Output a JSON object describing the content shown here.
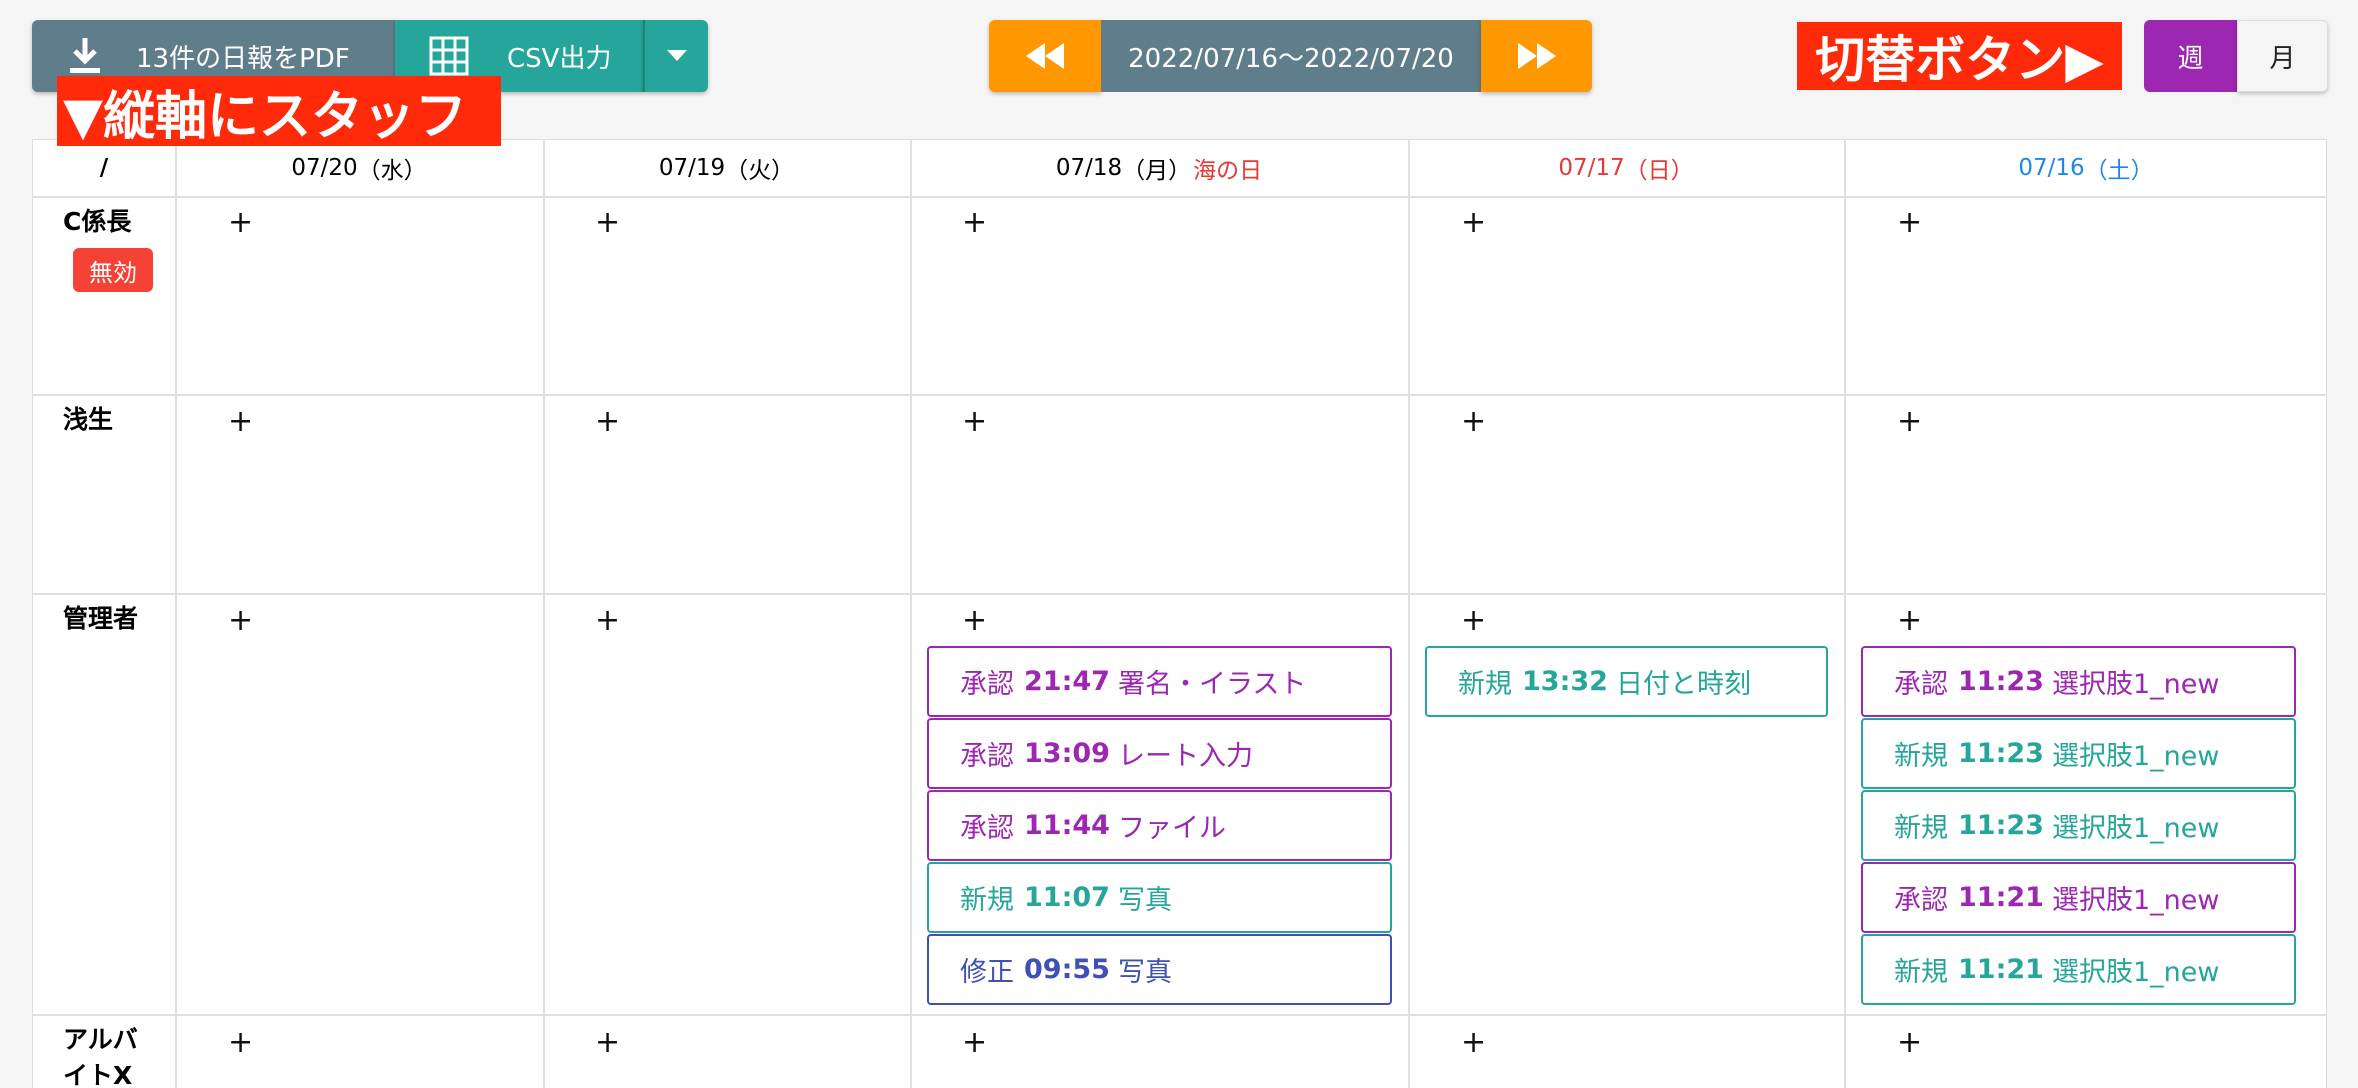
{
  "toolbar": {
    "pdf_label": "13件の日報をPDF",
    "csv_label": "CSV出力",
    "date_range": "2022/07/16〜2022/07/20",
    "week_label": "週",
    "month_label": "月",
    "annotation_switch": "切替ボタン▶",
    "annotation_staff": "▼縦軸にスタッフ"
  },
  "colors": {
    "pdf_button": "#607d8b",
    "csv_button": "#26a69a",
    "nav_button": "#ff9800",
    "week_active": "#9c27b0",
    "annotation": "#ff2a0a",
    "holiday": "#e53935",
    "saturday": "#1e88e5",
    "approve": "#9c27b0",
    "new": "#26a69a",
    "fix": "#3f51b5"
  },
  "grid": {
    "corner": "/",
    "add_symbol": "+",
    "columns": [
      {
        "date": "07/20",
        "weekday": "（水）",
        "holiday": ""
      },
      {
        "date": "07/19",
        "weekday": "（火）",
        "holiday": ""
      },
      {
        "date": "07/18",
        "weekday": "（月）",
        "holiday": "海の日"
      },
      {
        "date": "07/17",
        "weekday": "（日）",
        "holiday": ""
      },
      {
        "date": "07/16",
        "weekday": "（土）",
        "holiday": ""
      }
    ],
    "rows": [
      {
        "name": "C係長",
        "badge": "無効"
      },
      {
        "name": "浅生"
      },
      {
        "name": "管理者"
      },
      {
        "name": "アルバイトX"
      }
    ],
    "events": {
      "col3": [
        {
          "status": "承認",
          "time": "21:47",
          "title": "署名・イラスト"
        },
        {
          "status": "承認",
          "time": "13:09",
          "title": "レート入力"
        },
        {
          "status": "承認",
          "time": "11:44",
          "title": "ファイル"
        },
        {
          "status": "新規",
          "time": "11:07",
          "title": "写真"
        },
        {
          "status": "修正",
          "time": "09:55",
          "title": "写真"
        }
      ],
      "col4": [
        {
          "status": "新規",
          "time": "13:32",
          "title": "日付と時刻"
        }
      ],
      "col5": [
        {
          "status": "承認",
          "time": "11:23",
          "title": "選択肢1_new"
        },
        {
          "status": "新規",
          "time": "11:23",
          "title": "選択肢1_new"
        },
        {
          "status": "新規",
          "time": "11:23",
          "title": "選択肢1_new"
        },
        {
          "status": "承認",
          "time": "11:21",
          "title": "選択肢1_new"
        },
        {
          "status": "新規",
          "time": "11:21",
          "title": "選択肢1_new"
        }
      ]
    }
  }
}
